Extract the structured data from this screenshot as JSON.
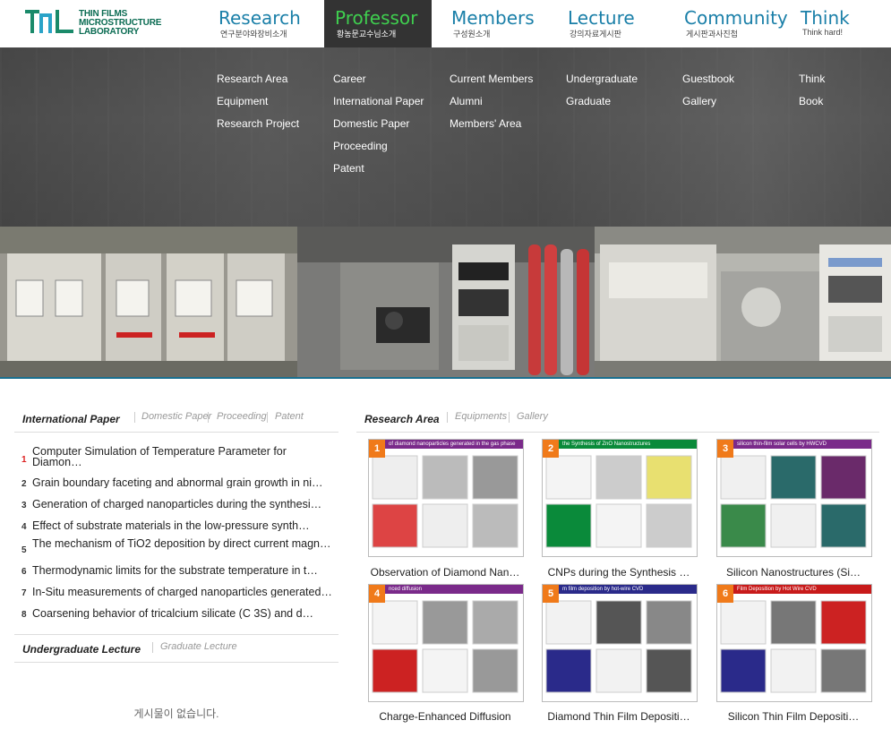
{
  "logo": {
    "line1": "THIN FILMS",
    "line2": "MICROSTRUCTURE",
    "line3": "LABORATORY",
    "mark": "TFML"
  },
  "nav": [
    {
      "en": "Research",
      "ko": "연구분야와장비소개"
    },
    {
      "en": "Professor",
      "ko": "황농문교수님소개"
    },
    {
      "en": "Members",
      "ko": "구성원소개"
    },
    {
      "en": "Lecture",
      "ko": "강의자료게시판"
    },
    {
      "en": "Community",
      "ko": "게시판과사진첩"
    },
    {
      "en": "Think",
      "ko": "Think hard!"
    }
  ],
  "mega": [
    [
      "Research Area",
      "Equipment",
      "Research Project"
    ],
    [
      "Career",
      "International Paper",
      "Domestic Paper",
      "Proceeding",
      "Patent"
    ],
    [
      "Current Members",
      "Alumni",
      "Members' Area"
    ],
    [
      "Undergraduate",
      "Graduate"
    ],
    [
      "Guestbook",
      "Gallery"
    ],
    [
      "Think",
      "Book"
    ]
  ],
  "papers": {
    "tab_active": "International Paper",
    "tabs": [
      "Domestic Paper",
      "Proceeding",
      "Patent"
    ],
    "items": [
      {
        "num": "1",
        "title": "Computer Simulation of Temperature Parameter for Diamon…"
      },
      {
        "num": "2",
        "title": "Grain boundary faceting and abnormal grain growth in ni…"
      },
      {
        "num": "3",
        "title": "Generation of charged nanoparticles during the synthesi…"
      },
      {
        "num": "4",
        "title": "Effect of substrate materials in the low-pressure synth…"
      },
      {
        "num": "5",
        "title": "The mechanism of TiO2 deposition by direct current magn…"
      },
      {
        "num": "6",
        "title": "Thermodynamic limits for the substrate temperature in t…"
      },
      {
        "num": "7",
        "title": "In-Situ measurements of charged nanoparticles generated…"
      },
      {
        "num": "8",
        "title": "Coarsening behavior of tricalcium silicate (C 3S) and d…"
      }
    ]
  },
  "lecture": {
    "tab_active": "Undergraduate Lecture",
    "tabs": [
      "Graduate Lecture"
    ],
    "empty": "게시물이 없습니다."
  },
  "research": {
    "tab_active": "Research Area",
    "tabs": [
      "Equipments",
      "Gallery"
    ],
    "items": [
      {
        "num": "1",
        "title": "Observation of Diamond Nan…",
        "header": "of diamond nanoparticles generated in the gas phase",
        "color": "#7a2a8a"
      },
      {
        "num": "2",
        "title": "CNPs during the Synthesis …",
        "header": "the Synthesis of ZnO Nanostructures",
        "color": "#0a8a3a"
      },
      {
        "num": "3",
        "title": "Silicon Nanostructures (Si…",
        "header": "silicon thin-film solar cells by HWCVD",
        "color": "#7a2a8a"
      },
      {
        "num": "4",
        "title": "Charge-Enhanced Diffusion",
        "header": "nced diffusion",
        "color": "#7a2a8a"
      },
      {
        "num": "5",
        "title": "Diamond Thin Film Depositi…",
        "header": "m film deposition by hot-wire CVD",
        "color": "#2a2a8a"
      },
      {
        "num": "6",
        "title": "Silicon Thin Film Depositi…",
        "header": "Film Deposition by Hot Wire CVD",
        "color": "#c81a1a"
      }
    ]
  }
}
